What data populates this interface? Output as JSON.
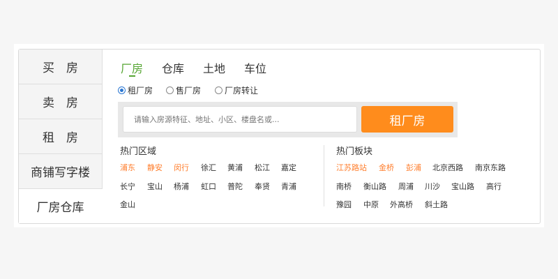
{
  "sidebar": {
    "items": [
      {
        "label": "买　房",
        "active": false
      },
      {
        "label": "卖　房",
        "active": false
      },
      {
        "label": "租　房",
        "active": false
      },
      {
        "label": "商铺写字楼",
        "active": false
      },
      {
        "label": "厂房仓库",
        "active": true
      }
    ]
  },
  "tabs": [
    {
      "label": "厂房",
      "active": true
    },
    {
      "label": "仓库",
      "active": false
    },
    {
      "label": "土地",
      "active": false
    },
    {
      "label": "车位",
      "active": false
    }
  ],
  "radios": [
    {
      "label": "租厂房",
      "checked": true
    },
    {
      "label": "售厂房",
      "checked": false
    },
    {
      "label": "厂房转让",
      "checked": false
    }
  ],
  "search": {
    "placeholder": "请输入房源特征、地址、小区、楼盘名或...",
    "button_label": "租厂房"
  },
  "hot_areas": {
    "title": "热门区域",
    "links": [
      {
        "label": "浦东",
        "highlight": true
      },
      {
        "label": "静安",
        "highlight": true
      },
      {
        "label": "闵行",
        "highlight": true
      },
      {
        "label": "徐汇",
        "highlight": false
      },
      {
        "label": "黄浦",
        "highlight": false
      },
      {
        "label": "松江",
        "highlight": false
      },
      {
        "label": "嘉定",
        "highlight": false
      },
      {
        "label": "长宁",
        "highlight": false
      },
      {
        "label": "宝山",
        "highlight": false
      },
      {
        "label": "杨浦",
        "highlight": false
      },
      {
        "label": "虹口",
        "highlight": false
      },
      {
        "label": "普陀",
        "highlight": false
      },
      {
        "label": "奉贤",
        "highlight": false
      },
      {
        "label": "青浦",
        "highlight": false
      },
      {
        "label": "金山",
        "highlight": false
      }
    ]
  },
  "hot_blocks": {
    "title": "热门板块",
    "links": [
      {
        "label": "江苏路站",
        "highlight": true
      },
      {
        "label": "金桥",
        "highlight": true
      },
      {
        "label": "彭浦",
        "highlight": true
      },
      {
        "label": "北京西路",
        "highlight": false
      },
      {
        "label": "南京东路",
        "highlight": false
      },
      {
        "label": "南桥",
        "highlight": false
      },
      {
        "label": "衡山路",
        "highlight": false
      },
      {
        "label": "周浦",
        "highlight": false
      },
      {
        "label": "川沙",
        "highlight": false
      },
      {
        "label": "宝山路",
        "highlight": false
      },
      {
        "label": "高行",
        "highlight": false
      },
      {
        "label": "豫园",
        "highlight": false
      },
      {
        "label": "中原",
        "highlight": false
      },
      {
        "label": "外高桥",
        "highlight": false
      },
      {
        "label": "斜土路",
        "highlight": false
      }
    ]
  },
  "colors": {
    "accent_green": "#55a532",
    "highlight_orange": "#ff7e2d",
    "button_orange": "#ff8c1c",
    "radio_blue": "#2a76d2"
  }
}
